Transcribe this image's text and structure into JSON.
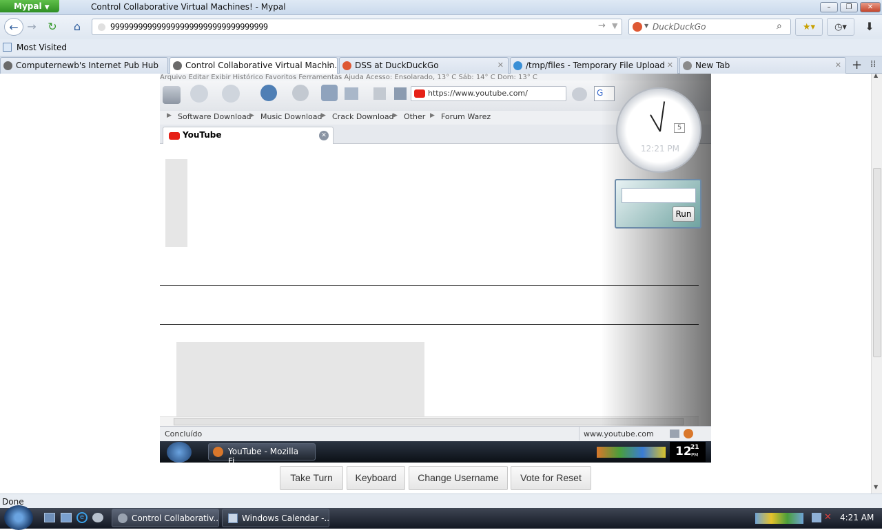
{
  "window": {
    "app_button": "Mypal",
    "title": "Control Collaborative Virtual Machines! - Mypal",
    "controls": [
      "–",
      "❐",
      "✕"
    ]
  },
  "nav": {
    "url": "9999999999999999999999999999999999",
    "search_placeholder": "DuckDuckGo"
  },
  "bookmarks": {
    "most_visited": "Most Visited"
  },
  "tabs": [
    {
      "label": "Computernewb's Internet Pub Hub",
      "color": "#6a6a6a"
    },
    {
      "label": "Control Collaborative Virtual Machin...",
      "color": "#6a6a6a"
    },
    {
      "label": "DSS at DuckDuckGo",
      "color": "#de5833"
    },
    {
      "label": "/tmp/files - Temporary File Upload",
      "color": "#3a8fd6"
    },
    {
      "label": "New Tab",
      "color": "#8a8a8a"
    }
  ],
  "vm": {
    "menu_text": "Arquivo  Editar  Exibir  Histórico  Favoritos  Ferramentas  Ajuda    Acesso: Ensolarado, 13° C     Sáb: 14° C    Dom: 13° C",
    "url": "https://www.youtube.com/",
    "links": [
      "Software Download",
      "Music Download",
      "Crack Download",
      "Other",
      "Forum Warez"
    ],
    "tab_label": "YouTube",
    "status_left": "Concluído",
    "status_right": "www.youtube.com",
    "task_label": "YouTube - Mozilla Fi...",
    "clock_hour": "12",
    "clock_min": "21",
    "clock_ampm": "PM",
    "gadget_time": "12:21 PM",
    "gadget_date": "5",
    "run_button": "Run"
  },
  "controls": {
    "take_turn": "Take Turn",
    "keyboard": "Keyboard",
    "change_username": "Change Username",
    "vote_reset": "Vote for Reset"
  },
  "status": "Done",
  "taskbar": {
    "items": [
      "Control Collaborativ...",
      "Windows Calendar -..."
    ],
    "clock": "4:21 AM"
  }
}
